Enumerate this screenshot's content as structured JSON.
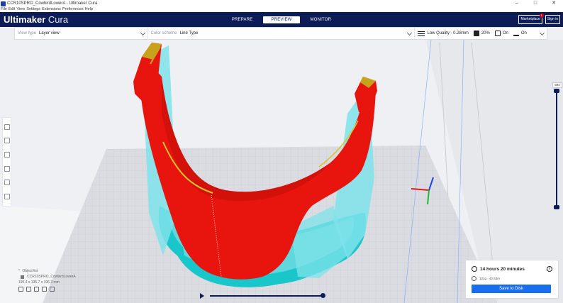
{
  "window": {
    "title": "CCR10SPRO_CowbirdLowerA - Ultimaker Cura",
    "controls": [
      "–",
      "□",
      "✕"
    ]
  },
  "menu": [
    "File",
    "Edit",
    "View",
    "Settings",
    "Extensions",
    "Preferences",
    "Help"
  ],
  "header": {
    "logo_bold": "Ultimaker",
    "logo_light": "Cura",
    "stages": [
      "PREPARE",
      "PREVIEW",
      "MONITOR"
    ],
    "active_stage": "PREVIEW",
    "marketplace_label": "Marketplace",
    "marketplace_badge": "1",
    "signin_label": "Sign in"
  },
  "settings_bar": {
    "view_type_label": "View type",
    "view_type_value": "Layer view",
    "color_scheme_label": "Color scheme",
    "color_scheme_value": "Line Type",
    "quality": "Low Quality - 0.28mm",
    "infill": "20%",
    "support": "On",
    "adhesion": "On"
  },
  "layer_slider": {
    "current_layer": "594"
  },
  "object_list": {
    "header": "Object list",
    "object_name": "CCR10SPRO_CowbirdLowerA",
    "dimensions": "195.4 x 135.7 x 196.3 mm"
  },
  "print_panel": {
    "time": "14 hours 20 minutes",
    "material": "121g · 40.53m",
    "save_label": "Save to Disk",
    "info_glyph": "i"
  },
  "colors": {
    "header_bg": "#0c1c56",
    "model_red": "#e8140e",
    "support_cyan": "#7fe3ea",
    "skirt_teal": "#19c6c9",
    "accent_blue": "#196ef0"
  }
}
